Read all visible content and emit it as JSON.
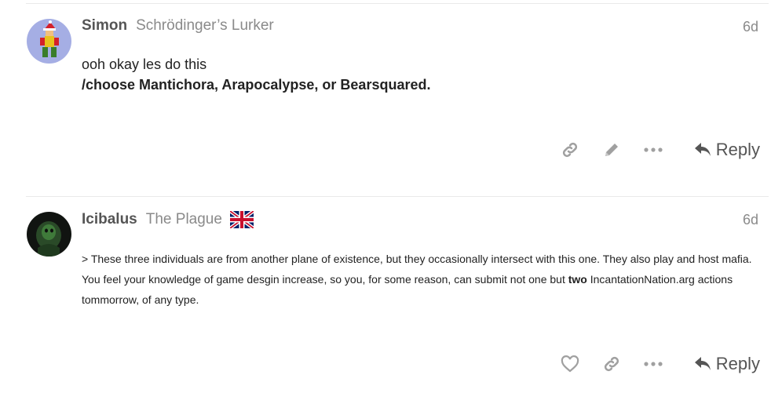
{
  "posts": [
    {
      "username": "Simon",
      "user_title": "Schrödinger’s Lurker",
      "date": "6d",
      "body_line1": "ooh okay les do this",
      "body_line2": "/choose Mantichora, Arapocalypse, or Bearsquared.",
      "reply_label": "Reply",
      "actions": [
        "link-icon",
        "edit-icon",
        "more-icon"
      ]
    },
    {
      "username": "Icibalus",
      "user_title": "The Plague",
      "flag": "uk-flag-icon",
      "date": "6d",
      "body_part1": "> These three individuals are from another plane of existence, but they occasionally intersect with this one. They also play and host mafia. You feel your knowledge of game desgin increase, so you, for some reason, can submit not one but ",
      "body_bold": "two",
      "body_part2": " IncantationNation.arg actions tommorrow, of any type.",
      "reply_label": "Reply",
      "actions": [
        "heart-icon",
        "link-icon",
        "more-icon"
      ]
    }
  ],
  "colors": {
    "muted": "#8a8a8a",
    "icon": "#a0a0a0",
    "text": "#222222"
  }
}
